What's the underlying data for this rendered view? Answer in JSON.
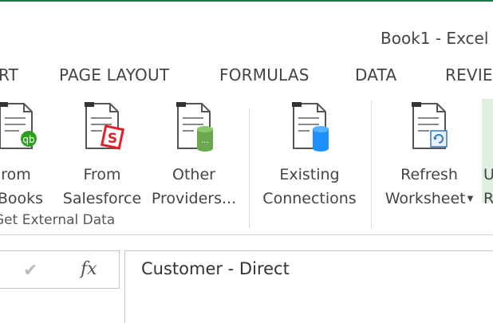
{
  "window": {
    "title": "Book1 - Excel"
  },
  "tabs": [
    "RT",
    "PAGE LAYOUT",
    "FORMULAS",
    "DATA",
    "REVIEW"
  ],
  "ribbon": {
    "buttons": [
      {
        "name": "from-quickbooks",
        "line1": "rom",
        "line2": "kBooks",
        "icon": "document-quickbooks-icon"
      },
      {
        "name": "from-salesforce",
        "line1": "From",
        "line2": "Salesforce",
        "icon": "document-salesforce-icon"
      },
      {
        "name": "other-providers",
        "line1": "Other",
        "line2": "Providers...",
        "icon": "document-database-icon"
      },
      {
        "name": "existing-connections",
        "line1": "Existing",
        "line2": "Connections",
        "icon": "document-connection-icon"
      },
      {
        "name": "refresh-worksheet",
        "line1": "Refresh",
        "line2": "Worksheet",
        "icon": "document-refresh-icon"
      },
      {
        "name": "partial-button",
        "line1": "U",
        "line2": "R"
      }
    ],
    "group_label": "Get External Data"
  },
  "formula_bar": {
    "fx_label": "fx",
    "value": "Customer - Direct"
  },
  "colors": {
    "accent": "#217346",
    "salesforce": "#e32028",
    "quickbooks": "#2ca01c",
    "database_green": "#6aa84f",
    "database_blue": "#1e90ff"
  }
}
